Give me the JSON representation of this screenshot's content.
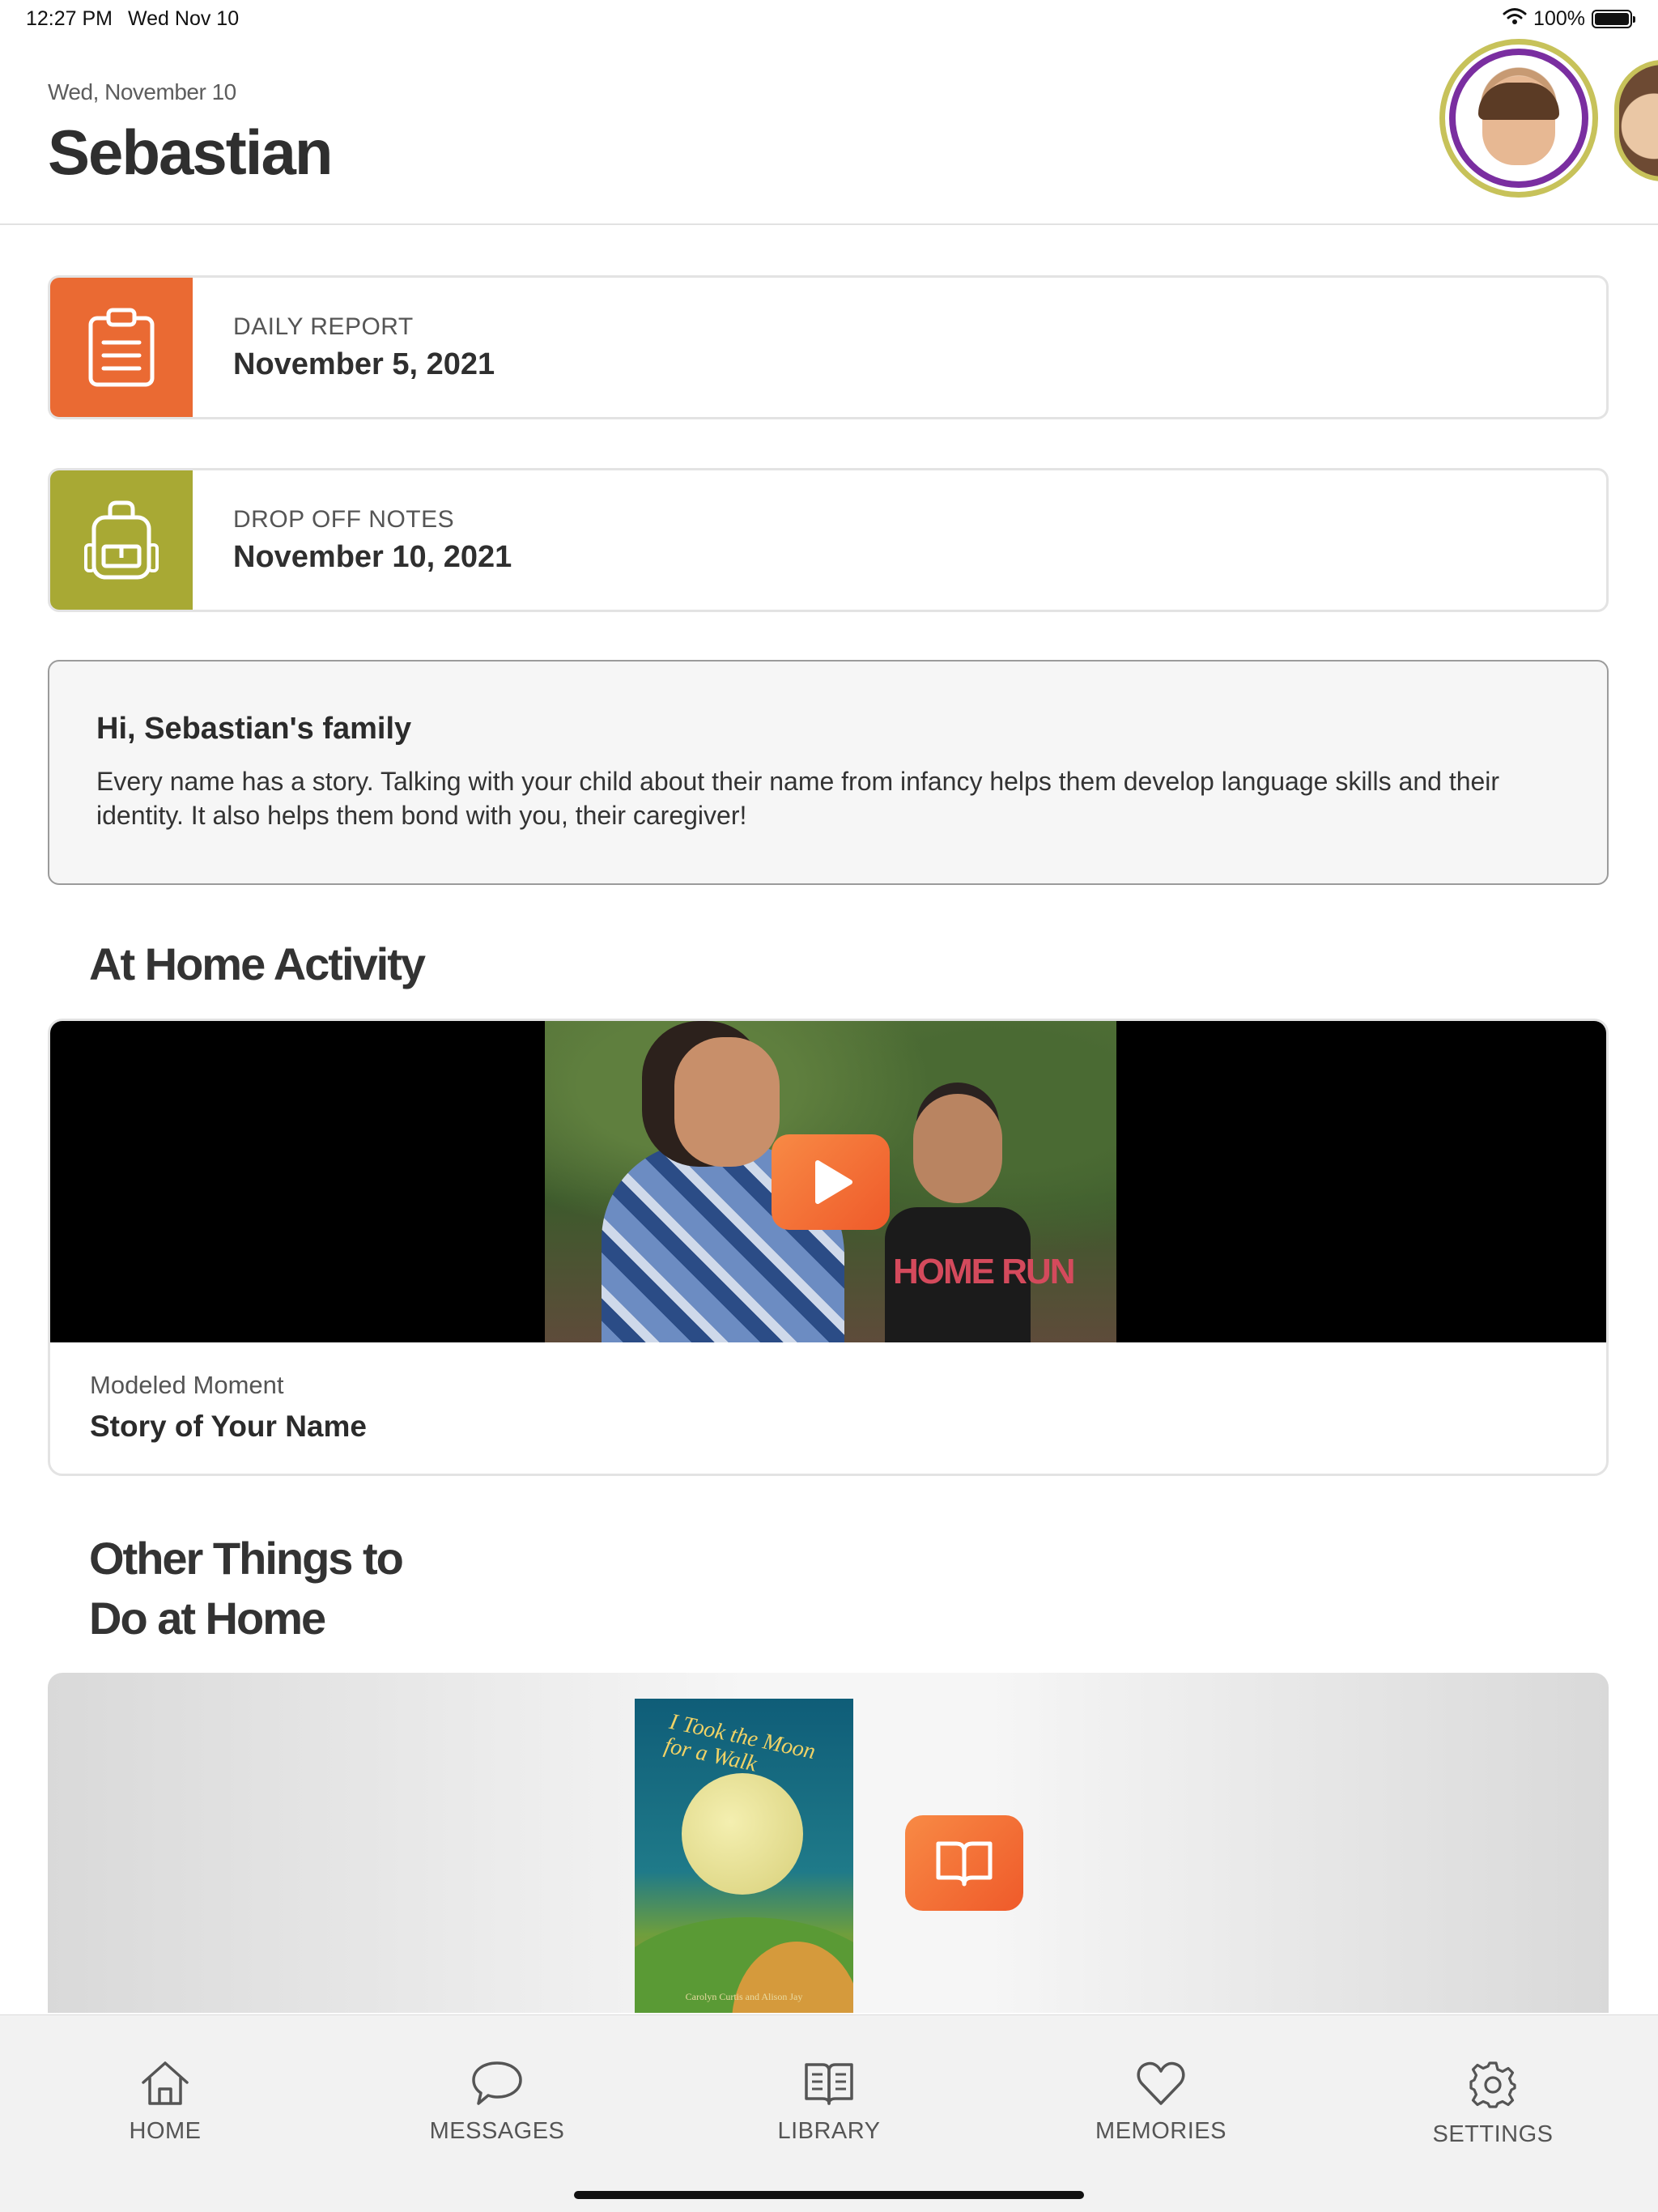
{
  "status_bar": {
    "time": "12:27 PM",
    "date": "Wed Nov 10",
    "battery": "100%"
  },
  "header": {
    "date": "Wed, November 10",
    "child_name": "Sebastian"
  },
  "cards": {
    "daily_report": {
      "label": "DAILY REPORT",
      "date": "November 5, 2021",
      "icon": "clipboard-icon",
      "color": "#EA6A33"
    },
    "drop_off_notes": {
      "label": "DROP OFF NOTES",
      "date": "November 10, 2021",
      "icon": "backpack-icon",
      "color": "#A8A934"
    }
  },
  "greeting": {
    "title": "Hi, Sebastian's family",
    "body": "Every name has a story. Talking with your child about their name from infancy helps them develop language skills and their identity. It also helps them bond with you, their caregiver!"
  },
  "at_home": {
    "section_title": "At Home Activity",
    "video": {
      "thumbnail_text": "HOME RUN",
      "caption_label": "Modeled Moment",
      "caption_title": "Story of Your Name"
    }
  },
  "other_things": {
    "section_title_line1": "Other Things to",
    "section_title_line2": "Do at Home",
    "book": {
      "title": "I Took the Moon for a Walk",
      "authors": "Carolyn Curtis and Alison Jay"
    }
  },
  "tab_bar": {
    "tabs": [
      {
        "label": "HOME",
        "icon": "home-icon"
      },
      {
        "label": "MESSAGES",
        "icon": "chat-bubble-icon"
      },
      {
        "label": "LIBRARY",
        "icon": "open-book-icon"
      },
      {
        "label": "MEMORIES",
        "icon": "heart-icon"
      },
      {
        "label": "SETTINGS",
        "icon": "gear-icon"
      }
    ]
  },
  "colors": {
    "accent_orange": "#EF6A33",
    "accent_olive": "#A8A934",
    "avatar_ring": "#7A2EA0"
  }
}
